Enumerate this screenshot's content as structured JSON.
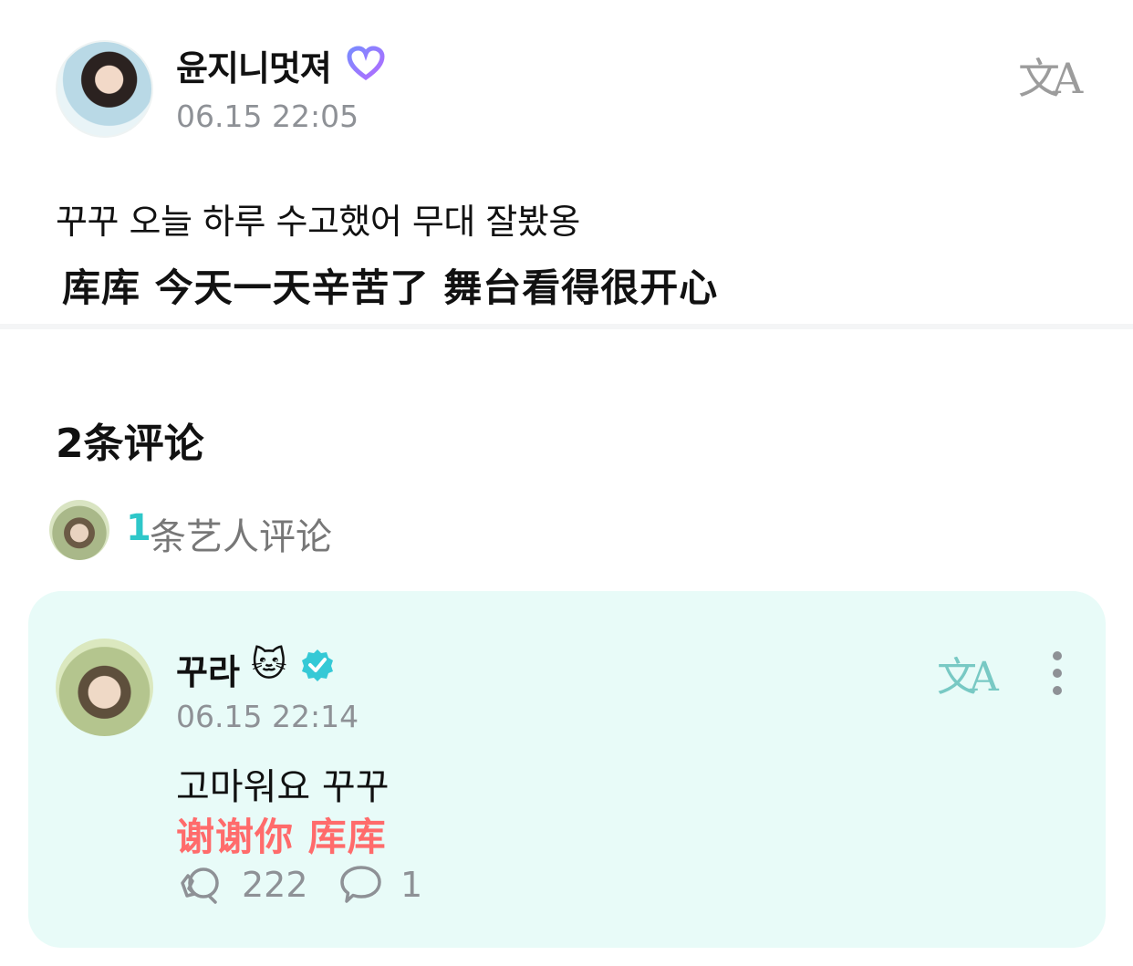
{
  "post": {
    "author_name": "윤지니멋져",
    "timestamp": "06.15 22:05",
    "text": "꾸꾸 오늘 하루 수고했어 무대 잘봤옹",
    "translated_text": "库库 今天一天辛苦了 舞台看得很开心",
    "translate_icon": "translate-icon"
  },
  "comments_section": {
    "count_label": "2条评论",
    "artist_count": "1",
    "artist_label": "条艺人评论"
  },
  "comment": {
    "author_name": "꾸라",
    "emoji": "🐱",
    "timestamp": "06.15 22:14",
    "text": "고마워요 꾸꾸",
    "translated_text": "谢谢你 库库",
    "like_count": "222",
    "reply_count": "1",
    "accent_color": "#2ec7c9",
    "translated_color": "#ff6b6b"
  }
}
